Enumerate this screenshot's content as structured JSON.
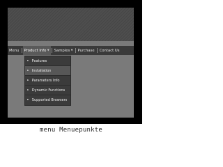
{
  "menubar": {
    "items": [
      {
        "label": "Menu"
      },
      {
        "label": "Product Info",
        "arrow": "▼"
      },
      {
        "label": "Samples",
        "arrow": "▼"
      },
      {
        "label": "Purchase"
      },
      {
        "label": "Contact Us"
      }
    ]
  },
  "submenu": {
    "items": [
      {
        "label": "Features",
        "arrow": "►"
      },
      {
        "label": "Installation",
        "arrow": "►"
      },
      {
        "label": "Parameters Info",
        "arrow": "►"
      },
      {
        "label": "Dynamic Functions",
        "arrow": "►"
      },
      {
        "label": "Supported Browsers",
        "arrow": "►"
      }
    ]
  },
  "caption": "menu Menuepunkte",
  "colors": {
    "frame": "#000000",
    "panel": "#7a7a7a",
    "header_band": "#4e4e4e",
    "menubar": "#3a3a3a",
    "submenu": "#3b3b3b",
    "submenu_hover": "#575757",
    "text": "#f0f0f0"
  }
}
